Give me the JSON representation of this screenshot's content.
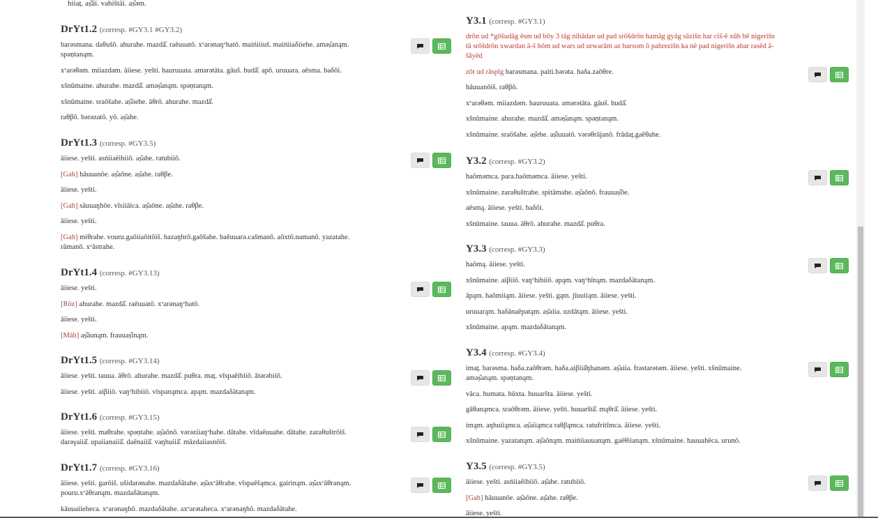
{
  "left": {
    "topline": "hiiaṯ. aṣ̌āi. vahištāi. aṣ̌əm.",
    "sections": [
      {
        "title": "DrYt1.2",
        "corresp": "(corresp. #GY3.1 #GY3.2)",
        "lines": [
          {
            "tag": "",
            "text": "barəsmana. daθušō. ahurahe. mazdā̊. raēuuatō. xᵛarənaŋᵛhatō. maińiiiuš. maińiiaδiiehe. aməṣ̌anąm. spəṇtanąm."
          },
          {
            "tag": "",
            "text": "xᵛarəθəm. miiazdəm. āiiese. yešti. hauruuata. amərətāta. gāuš. hudā̊. apō. uruuara. aēsma. baδōi."
          },
          {
            "tag": "",
            "text": "xšnūmaine. ahurahe. mazdā̊. aməṣ̌anąm. spəṇtanąm."
          },
          {
            "tag": "",
            "text": "xšnūmaine. sraōšahe. aṣ̌iiehe. āθrō. ahurahe. mazdā̊."
          },
          {
            "tag": "",
            "text": "raθβō. bərəzatō. yō. aṣ̌ahe."
          }
        ]
      },
      {
        "title": "DrYt1.3",
        "corresp": "(corresp. #GY3.5)",
        "lines": [
          {
            "tag": "",
            "text": "āiiese. yešti. asńiiaēibiiō. aṣ̌ahe. ratubiiō."
          },
          {
            "tag": "[Gah]",
            "text": "hāuuanōe. aṣ̌aōne. aṣ̌ahe. raθβe."
          },
          {
            "tag": "",
            "text": "āiiese. yešti."
          },
          {
            "tag": "[Gah]",
            "text": "sāuuaŋhōe. vīsiiāica. aṣ̌aōne. aṣ̌ahe. raθβe."
          },
          {
            "tag": "",
            "text": "āiiese. yešti."
          },
          {
            "tag": "[Gah]",
            "text": "miθrahe. vouru.gaōiiaōitōiš. hazaŋhrō.gaōšahe. baēuuarə.cašmanō. aōxtō.namanō. yazatahe. rāmanō. xᵛāstrahe."
          }
        ]
      },
      {
        "title": "DrYt1.4",
        "corresp": "(corresp. #GY3.13)",
        "lines": [
          {
            "tag": "",
            "text": "āiiese. yešti."
          },
          {
            "tag": "[Rōz]",
            "text": "ahurahe. mazdā̊. raēuuatō. xᵛarənaŋᵛhatō."
          },
          {
            "tag": "",
            "text": "āiiese. yešti."
          },
          {
            "tag": "[Māh]",
            "text": "aṣ̌āunąm. frauuaṣ̌inąm."
          }
        ]
      },
      {
        "title": "DrYt1.5",
        "corresp": "(corresp. #GY3.14)",
        "lines": [
          {
            "tag": "",
            "text": "āiiese. yešti. tauua. āθrō. ahurahe. mazdā̊. puθra. maṯ. vīspaēibiiō. ātərəbiiō."
          },
          {
            "tag": "",
            "text": "āiiese. yešti. aiβiiō. vaŋᵛhibiiō. vīspanąmca. apąm. mazdaδātanąm."
          }
        ]
      },
      {
        "title": "DrYt1.6",
        "corresp": "(corresp. #GY3.15)",
        "lines": [
          {
            "tag": "",
            "text": "āiiese. yešti. maθrahe. spəṇtahe. aṣ̌aōnō. vərəziiaŋᵛhahe. dātahe. vīdaēuuahe. dātahe. zaraθuštrōiš. darəγaiiā̊. upaiianaiiā̊. daēnaiiā̊. vaŋhuiiā̊. māzdaiiasnōiš."
          }
        ]
      },
      {
        "title": "DrYt1.7",
        "corresp": "(corresp. #GY3.16)",
        "lines": [
          {
            "tag": "",
            "text": "āiiese. yešti. garōiš. ušidarənahe. mazdaδātahe. aṣ̌axᵛāθrahe. vīspaēšąmca. gairinąm. aṣ̌axᵛāθranąm. pouru.xᵛāθranąm. mazdaδātanąm."
          },
          {
            "tag": "",
            "text": "kāuuaiieheca. xᵛarənaŋhō. mazdaδātahe. axᵛarətaheca. xᵛarənaŋhō. mazdaδātahe."
          }
        ]
      }
    ]
  },
  "right": {
    "sections": [
      {
        "title": "Y3.1",
        "corresp": "(corresp. #GY3.1)",
        "lines": [
          {
            "tag": "",
            "text": "drōn ud *gōšudāg ēsm ud bōy 3 tāg nihādan ud pad srōšdrōn hamāg gyāg sāzišn har ciš-ē xūb bē nigerišn tā srōšdrōn xwardan ā-š hōm ud wars ud urwarām az barsom ō pahrezišn ka nē pad nigerišn abar rasēd ā-šāyēd",
            "red": true
          },
          {
            "tag": "zōt ud rāspīg",
            "text": "barəsmana. paiti.bərəta. haδa.zaōθre.",
            "tagred": true
          },
          {
            "tag": "",
            "text": "hāuuanōiš. raθβō."
          },
          {
            "tag": "",
            "text": "xᵛarəθəm. miiazdəm. hauruuata. amərətāta. gāuš. hudā̊."
          },
          {
            "tag": "",
            "text": "xšnūmaine. ahurahe. mazdā̊. aməṣ̌anąm. spəṇtanąm."
          },
          {
            "tag": "",
            "text": "xšnūmaine. sraōšahe. aṣ̌ehe. aṣ̌iuuatō. vərəθrājanō. frādaṯ.gaēθahe."
          }
        ]
      },
      {
        "title": "Y3.2",
        "corresp": "(corresp. #GY3.2)",
        "lines": [
          {
            "tag": "",
            "text": "haōməmca. para.haōməmca. āiiese. yešti."
          },
          {
            "tag": "",
            "text": "xšnūmaine. zaraθuštrahe. spitāmahe. aṣ̌aōnō. frauuaṣ̌ōe."
          },
          {
            "tag": "",
            "text": "aēsmą. āiiese. yešti. baδōi."
          },
          {
            "tag": "",
            "text": "xšnūmaine. tauua. āθrō. ahurahe. mazdā̊. puθra."
          }
        ]
      },
      {
        "title": "Y3.3",
        "corresp": "(corresp. #GY3.3)",
        "lines": [
          {
            "tag": "",
            "text": "haōmą. āiiese. yešti."
          },
          {
            "tag": "",
            "text": "xšnūmaine. aiβiiō. vaŋᵛhibiiō. apąm. vaŋᵛhīnąm. mazdaδātanąm."
          },
          {
            "tag": "",
            "text": "āpąm. haōmiiąm. āiiese. yešti. gąm. jīuuiiąm. āiiese. yešti."
          },
          {
            "tag": "",
            "text": "uruuarąm. haδānaēpatąm. aṣ̌aiia. uzdātąm. āiiese. yešti."
          },
          {
            "tag": "",
            "text": "xšnūmaine. apąm. mazdaδātanąm."
          }
        ]
      },
      {
        "title": "Y3.4",
        "corresp": "(corresp. #GY3.4)",
        "lines": [
          {
            "tag": "",
            "text": "imaṯ. barəsma. haδa.zaōθrəm. haδa.aiβiiā̊ŋhanəm. aṣ̌aiia. frastarətəm. āiiese. yešti. xšnūmaine. aməṣ̌anąm. spəṇtanąm."
          },
          {
            "tag": "",
            "text": "vāca. humata. hūxta. huuaršta. āiiese. yešti."
          },
          {
            "tag": "",
            "text": "gāθanąmca. sraōθrəm. āiiese. yešti. huuarštā̊. mąθrā̊. āiiese. yešti."
          },
          {
            "tag": "",
            "text": "imąm. aŋhuiiąmca. aṣ̌aiiąmca raθβąmca. ratufritīmca. āiiese. yešti."
          },
          {
            "tag": "",
            "text": "xšnūmaine. yazatanąm. aṣ̌aōnąm. maińiiauuanąm. gaēθiianąm. xšnūmaine. hauuahēca. urunō."
          }
        ]
      },
      {
        "title": "Y3.5",
        "corresp": "(corresp. #GY3.5)",
        "lines": [
          {
            "tag": "",
            "text": "āiiese. yešti. asńiiaēibiiō. aṣ̌ahe. ratubiiō."
          },
          {
            "tag": "[Gah]",
            "text": "hāuuanōe. aṣ̌aōne. aṣ̌ahe. raθβe."
          },
          {
            "tag": "",
            "text": "āiiese. yešti."
          }
        ]
      }
    ]
  },
  "icons": {
    "comment": "comment-icon",
    "table": "table-icon"
  },
  "colors": {
    "tag": "#a94442",
    "red_text": "#c0392b",
    "green_button": "#5cb85c",
    "grey_button": "#e6e6e6"
  }
}
